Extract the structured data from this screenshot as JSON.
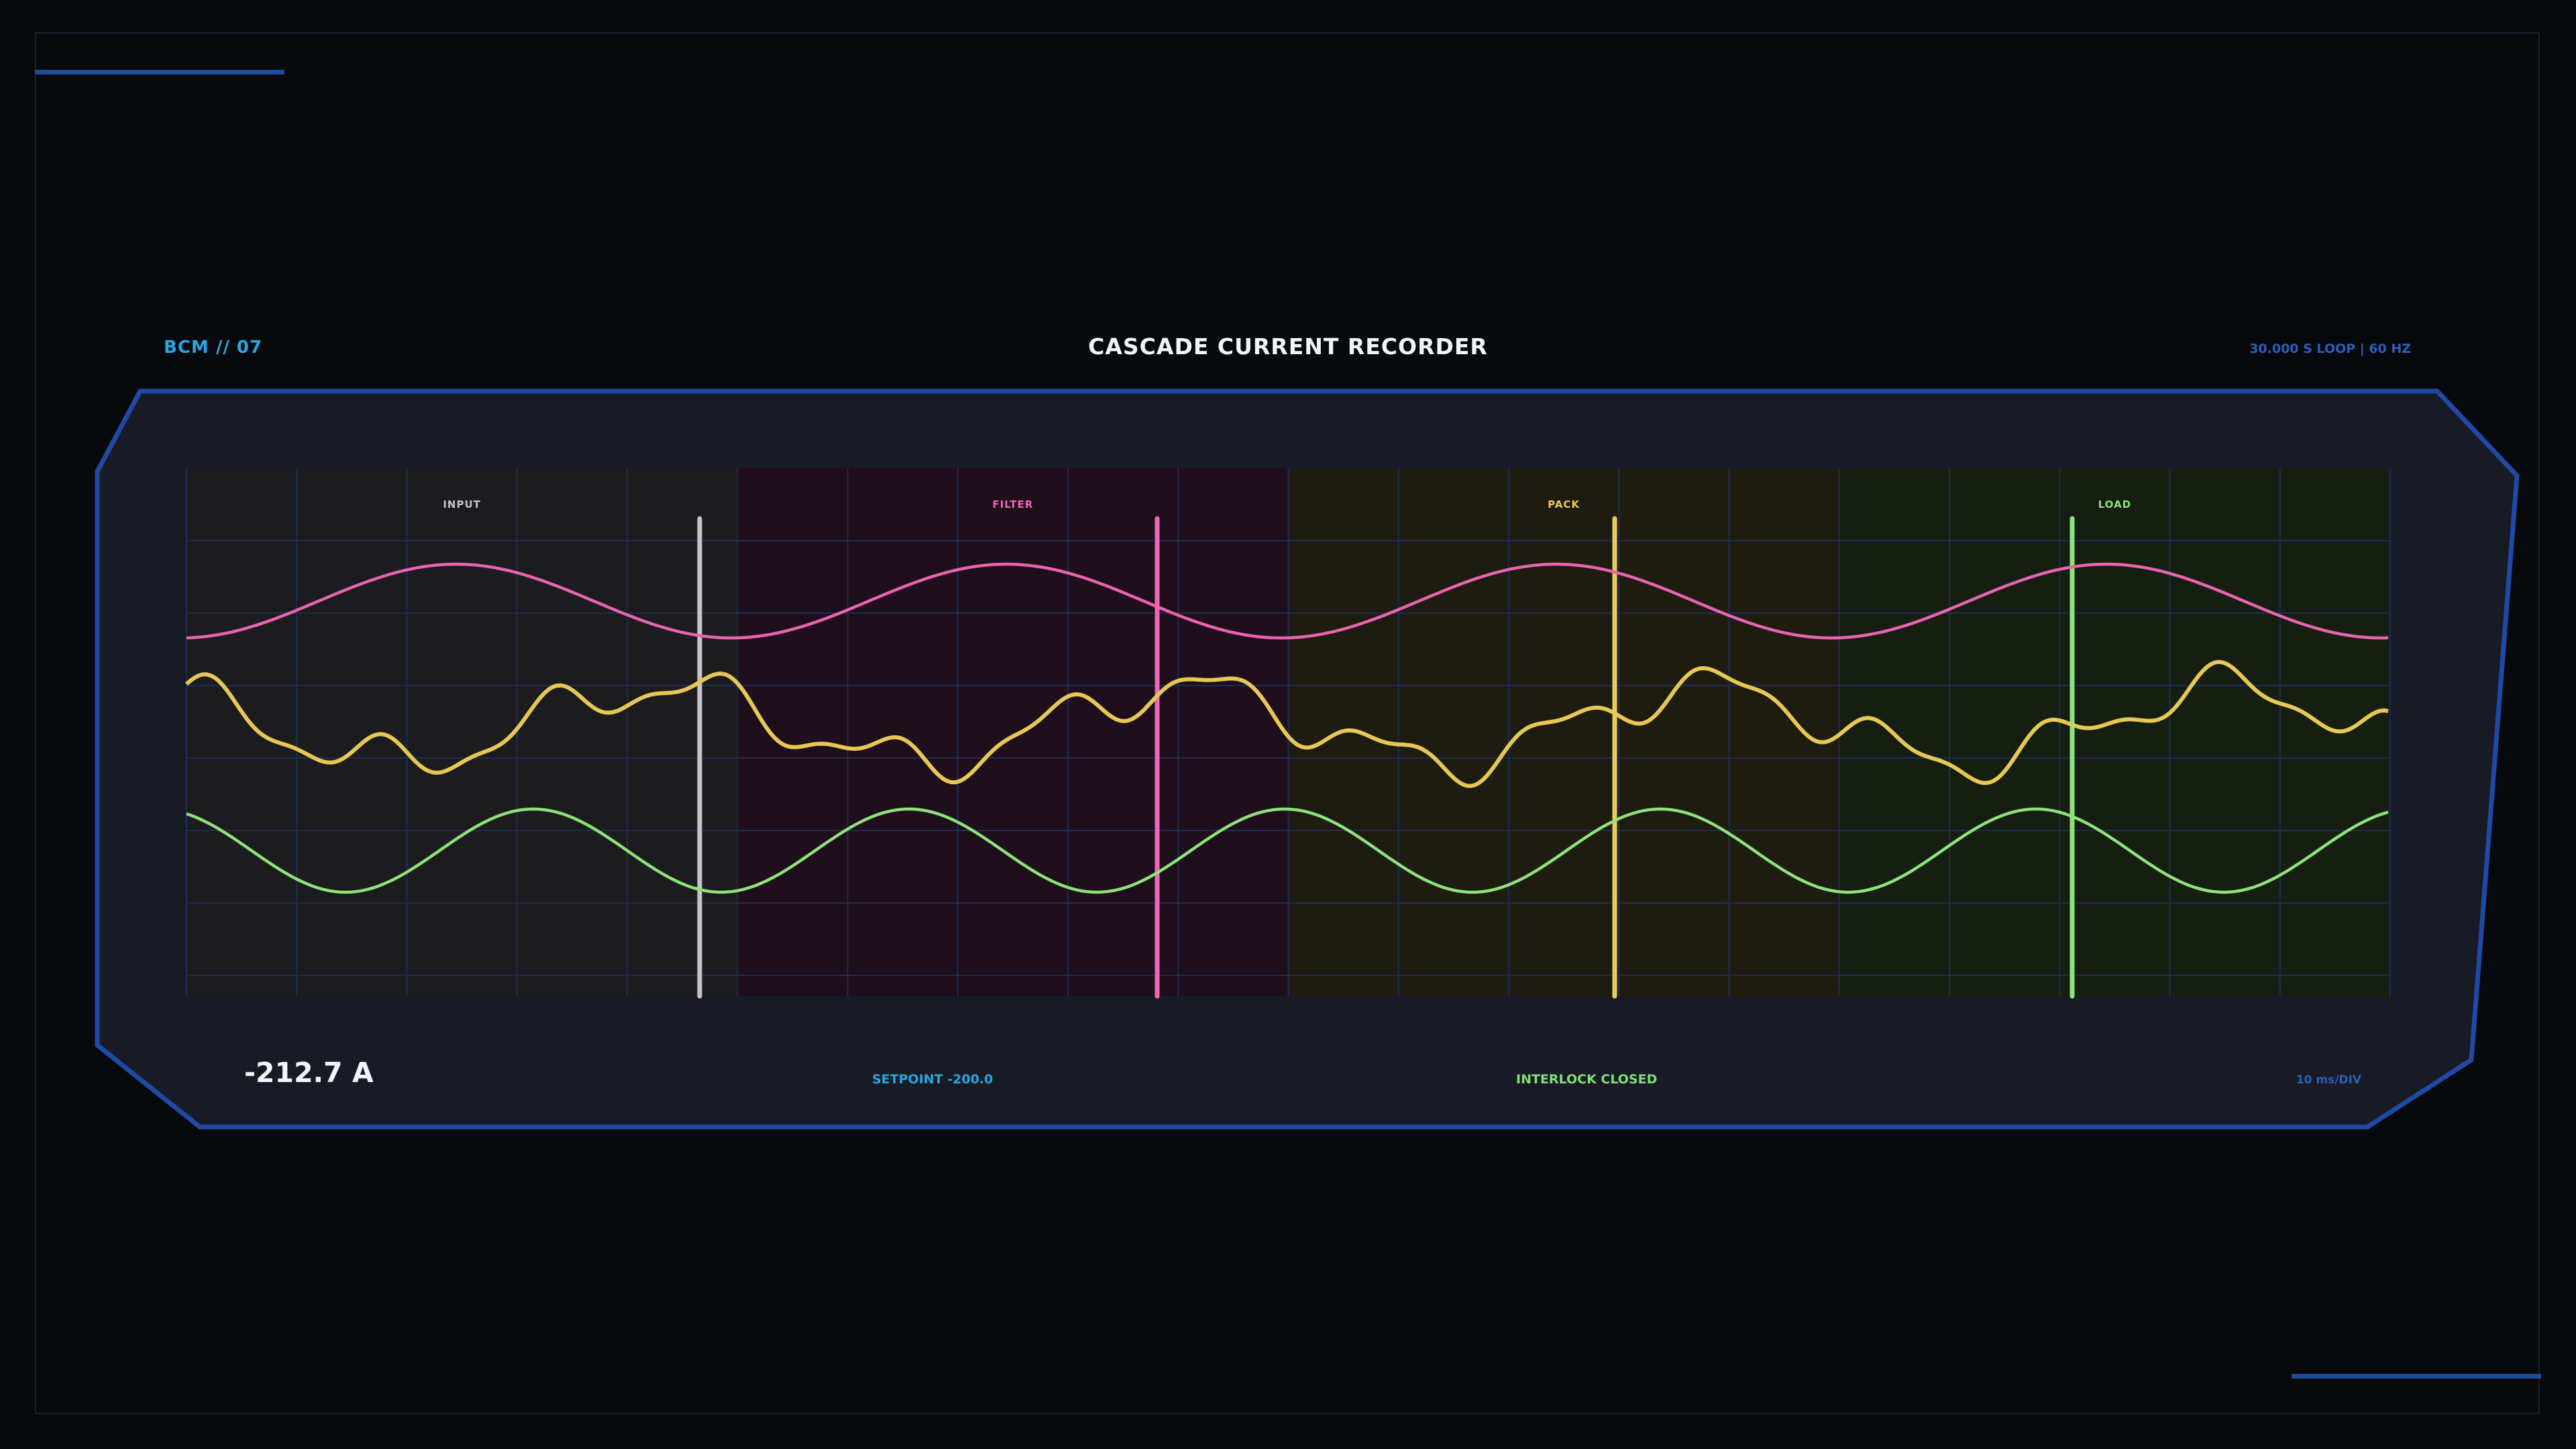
{
  "header": {
    "device_id": "BCM // 07",
    "title": "CASCADE CURRENT RECORDER",
    "loop_info": "30.000 S LOOP | 60 HZ"
  },
  "zones": [
    {
      "label": "INPUT",
      "color": "#c8c2cc",
      "tint": "#1c1c1e"
    },
    {
      "label": "FILTER",
      "color": "#ee66b4",
      "tint": "#1f0e1b"
    },
    {
      "label": "PACK",
      "color": "#e8cc5e",
      "tint": "#1e1b11"
    },
    {
      "label": "LOAD",
      "color": "#8ee27a",
      "tint": "#161e11"
    }
  ],
  "traces": [
    {
      "name": "pink",
      "color": "#e864b0"
    },
    {
      "name": "yellow",
      "color": "#e6c855"
    },
    {
      "name": "green",
      "color": "#8ee27a"
    }
  ],
  "footer": {
    "current_value": "-212.7 A",
    "setpoint": "SETPOINT -200.0",
    "interlock": "INTERLOCK CLOSED",
    "time_scale": "10 ms/DIV"
  },
  "colors": {
    "panel_border": "#1e4aa6",
    "panel_fill": "#181b25",
    "grid": "#1c2c52"
  }
}
